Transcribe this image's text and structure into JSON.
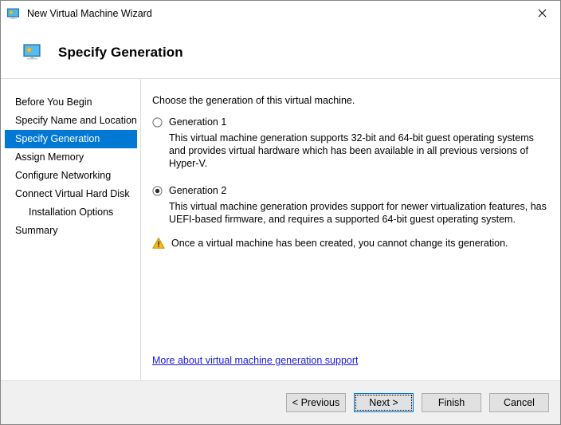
{
  "window": {
    "title": "New Virtual Machine Wizard",
    "title_icon": "virtual-machine-icon",
    "close_icon": "close-icon"
  },
  "header": {
    "icon": "virtual-machine-icon",
    "title": "Specify Generation"
  },
  "sidebar": {
    "items": [
      {
        "label": "Before You Begin",
        "selected": false,
        "indent": false
      },
      {
        "label": "Specify Name and Location",
        "selected": false,
        "indent": false
      },
      {
        "label": "Specify Generation",
        "selected": true,
        "indent": false
      },
      {
        "label": "Assign Memory",
        "selected": false,
        "indent": false
      },
      {
        "label": "Configure Networking",
        "selected": false,
        "indent": false
      },
      {
        "label": "Connect Virtual Hard Disk",
        "selected": false,
        "indent": false
      },
      {
        "label": "Installation Options",
        "selected": false,
        "indent": true
      },
      {
        "label": "Summary",
        "selected": false,
        "indent": false
      }
    ]
  },
  "content": {
    "intro": "Choose the generation of this virtual machine.",
    "options": [
      {
        "label": "Generation 1",
        "selected": false,
        "description": "This virtual machine generation supports 32-bit and 64-bit guest operating systems and provides virtual hardware which has been available in all previous versions of Hyper-V."
      },
      {
        "label": "Generation 2",
        "selected": true,
        "description": "This virtual machine generation provides support for newer virtualization features, has UEFI-based firmware, and requires a supported 64-bit guest operating system."
      }
    ],
    "warning": {
      "icon": "warning-triangle-icon",
      "text": "Once a virtual machine has been created, you cannot change its generation."
    },
    "link": "More about virtual machine generation support"
  },
  "footer": {
    "buttons": [
      {
        "label": "< Previous",
        "default": false
      },
      {
        "label": "Next >",
        "default": true
      },
      {
        "label": "Finish",
        "default": false
      },
      {
        "label": "Cancel",
        "default": false
      }
    ]
  },
  "colors": {
    "accent": "#0078d4",
    "focus_border": "#0078d7",
    "link": "#1a1ae6",
    "warning": "#f5b921",
    "footer_bg": "#f0f0f0"
  }
}
